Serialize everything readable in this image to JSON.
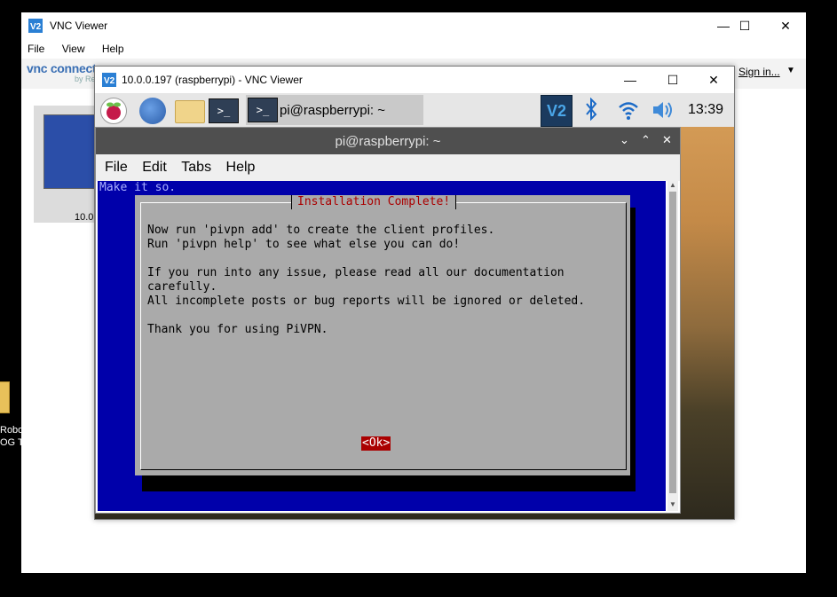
{
  "desktop": {
    "label_lines": [
      "Robo",
      "OG T"
    ]
  },
  "outer_window": {
    "title": "VNC Viewer",
    "controls": {
      "minimize": "—",
      "maximize": "☐",
      "close": "✕"
    },
    "menu": [
      "File",
      "View",
      "Help"
    ],
    "connect_logo": "vnc connect",
    "connect_by": "by Re",
    "sign_in": "Sign in...",
    "sign_in_arrow": "▼",
    "thumbnail_label": "10.0."
  },
  "inner_window": {
    "title": "10.0.0.197 (raspberrypi) - VNC Viewer",
    "controls": {
      "minimize": "—",
      "maximize": "☐",
      "close": "✕"
    }
  },
  "rpi_taskbar": {
    "terminal_icon_text": ">_",
    "active_task": "pi@raspberrypi: ~",
    "vnc_icon_text": "V2",
    "clock": "13:39"
  },
  "terminal": {
    "title": "pi@raspberrypi: ~",
    "controls": {
      "minimize": "⌄",
      "maximize": "⌃",
      "close": "✕"
    },
    "menu": [
      "File",
      "Edit",
      "Tabs",
      "Help"
    ],
    "first_line": "Make it so.",
    "dialog": {
      "title": "Installation Complete!",
      "body": "Now run 'pivpn add' to create the client profiles.\nRun 'pivpn help' to see what else you can do!\n\nIf you run into any issue, please read all our documentation\ncarefully.\nAll incomplete posts or bug reports will be ignored or deleted.\n\nThank you for using PiVPN.",
      "ok_label": "<Ok>"
    }
  },
  "colors": {
    "terminal_bg": "#0000aa",
    "dialog_bg": "#aaaaaa",
    "dialog_title": "#aa0000",
    "ok_bg": "#aa0000"
  },
  "icons": [
    "vnc-logo-icon",
    "raspberry-menu-icon",
    "web-browser-icon",
    "file-manager-icon",
    "terminal-icon",
    "bluetooth-icon",
    "wifi-icon",
    "volume-icon"
  ]
}
